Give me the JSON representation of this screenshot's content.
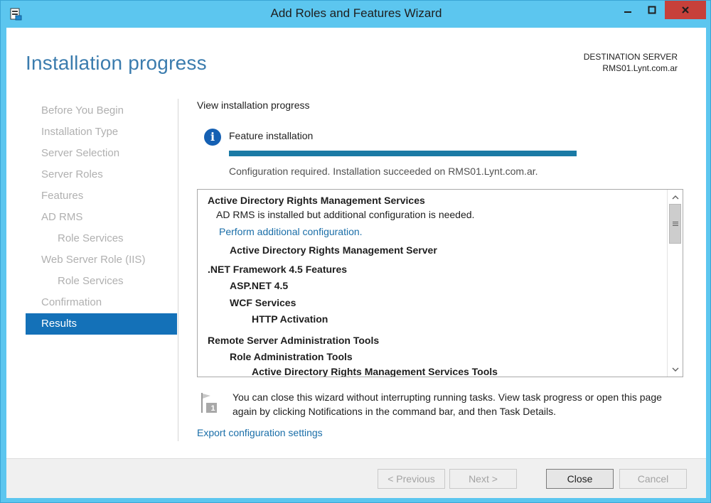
{
  "window": {
    "title": "Add Roles and Features Wizard"
  },
  "header": {
    "title": "Installation progress",
    "destination_label": "DESTINATION SERVER",
    "destination_server": "RMS01.Lynt.com.ar"
  },
  "nav": {
    "items": [
      {
        "label": "Before You Begin",
        "sub": false,
        "active": false
      },
      {
        "label": "Installation Type",
        "sub": false,
        "active": false
      },
      {
        "label": "Server Selection",
        "sub": false,
        "active": false
      },
      {
        "label": "Server Roles",
        "sub": false,
        "active": false
      },
      {
        "label": "Features",
        "sub": false,
        "active": false
      },
      {
        "label": "AD RMS",
        "sub": false,
        "active": false
      },
      {
        "label": "Role Services",
        "sub": true,
        "active": false
      },
      {
        "label": "Web Server Role (IIS)",
        "sub": false,
        "active": false
      },
      {
        "label": "Role Services",
        "sub": true,
        "active": false
      },
      {
        "label": "Confirmation",
        "sub": false,
        "active": false
      },
      {
        "label": "Results",
        "sub": false,
        "active": true
      }
    ]
  },
  "main": {
    "view_title": "View installation progress",
    "feature_label": "Feature installation",
    "progress_fraction": 1.0,
    "status_text": "Configuration required. Installation succeeded on RMS01.Lynt.com.ar.",
    "results": [
      {
        "text": "Active Directory Rights Management Services",
        "style": "bold",
        "level": 0
      },
      {
        "text": "AD RMS is installed but additional configuration is needed.",
        "style": "normal",
        "level": 1
      },
      {
        "text": "Perform additional configuration.",
        "style": "link",
        "level": 1
      },
      {
        "text": "Active Directory Rights Management Server",
        "style": "bold",
        "level": 2
      },
      {
        "text": ".NET Framework 4.5 Features",
        "style": "bold",
        "level": 0
      },
      {
        "text": "ASP.NET 4.5",
        "style": "bold",
        "level": 2
      },
      {
        "text": "WCF Services",
        "style": "bold",
        "level": 2
      },
      {
        "text": "HTTP Activation",
        "style": "bold",
        "level": 3
      },
      {
        "text": "Remote Server Administration Tools",
        "style": "bold",
        "level": 0
      },
      {
        "text": "Role Administration Tools",
        "style": "bold",
        "level": 2
      },
      {
        "text": "Active Directory Rights Management Services Tools",
        "style": "bold",
        "level": 3
      }
    ],
    "notification_text": "You can close this wizard without interrupting running tasks. View task progress or open this page again by clicking Notifications in the command bar, and then Task Details.",
    "notification_badge": "1",
    "export_link": "Export configuration settings"
  },
  "footer": {
    "previous_label": "< Previous",
    "next_label": "Next >",
    "close_label": "Close",
    "cancel_label": "Cancel"
  },
  "colors": {
    "accent": "#1471b8",
    "title_blue": "#3b7cae",
    "link": "#1a6ea8",
    "progress": "#1a7aa5",
    "window_frame": "#5cc6ef",
    "close_button": "#c7403a"
  }
}
